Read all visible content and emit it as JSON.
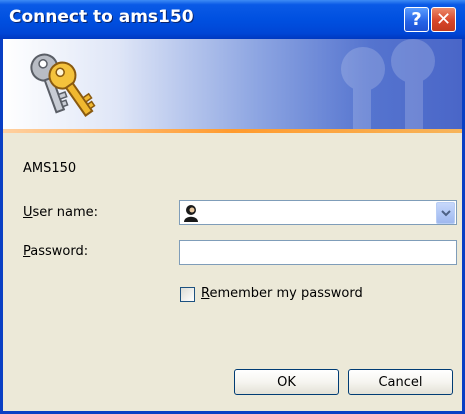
{
  "window": {
    "title": "Connect to ams150"
  },
  "titlebar": {
    "help_glyph": "?",
    "close_glyph": "✕"
  },
  "server_name": "AMS150",
  "form": {
    "username_label_first": "U",
    "username_label_rest": "ser name:",
    "username_value": "",
    "password_label_first": "P",
    "password_label_rest": "assword:",
    "password_value": "",
    "remember_label_first": "R",
    "remember_label_rest": "emember my password",
    "remember_checked": false
  },
  "buttons": {
    "ok": "OK",
    "cancel": "Cancel"
  },
  "colors": {
    "title_bar": "#0050e0",
    "banner_accent_line": "#ff9b2e",
    "dialog_bg": "#ece9d8",
    "close_button": "#d8462a"
  },
  "icons": {
    "banner": "keys-icon",
    "username_field": "user-icon",
    "dropdown": "chevron-down-icon"
  }
}
